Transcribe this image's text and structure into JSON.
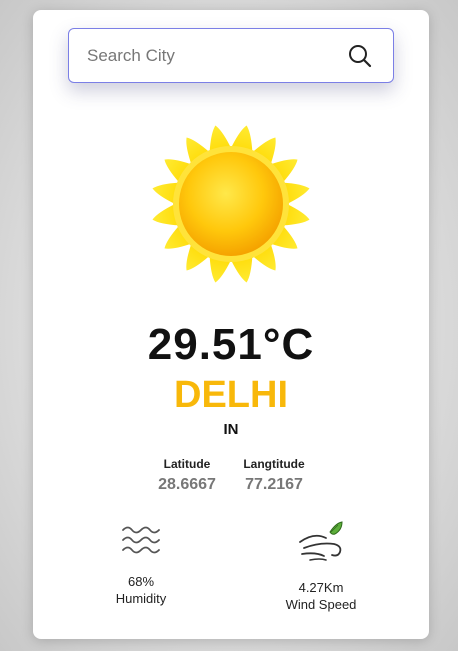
{
  "search": {
    "placeholder": "Search City",
    "value": ""
  },
  "weather": {
    "temperature": "29.51°C",
    "city": "DELHI",
    "country": "IN"
  },
  "coordinates": {
    "latitude_label": "Latitude",
    "latitude_value": "28.6667",
    "longitude_label": "Langtitude",
    "longitude_value": "77.2167"
  },
  "stats": {
    "humidity_value": "68%",
    "humidity_label": "Humidity",
    "wind_value": "4.27Km",
    "wind_label": "Wind Speed"
  },
  "icons": {
    "search": "search-icon",
    "weather": "sun-icon",
    "humidity": "waves-icon",
    "wind": "wind-leaf-icon"
  },
  "colors": {
    "accent": "#f8b80a",
    "search_border": "#7b7fe6",
    "coord_value": "#777777"
  }
}
